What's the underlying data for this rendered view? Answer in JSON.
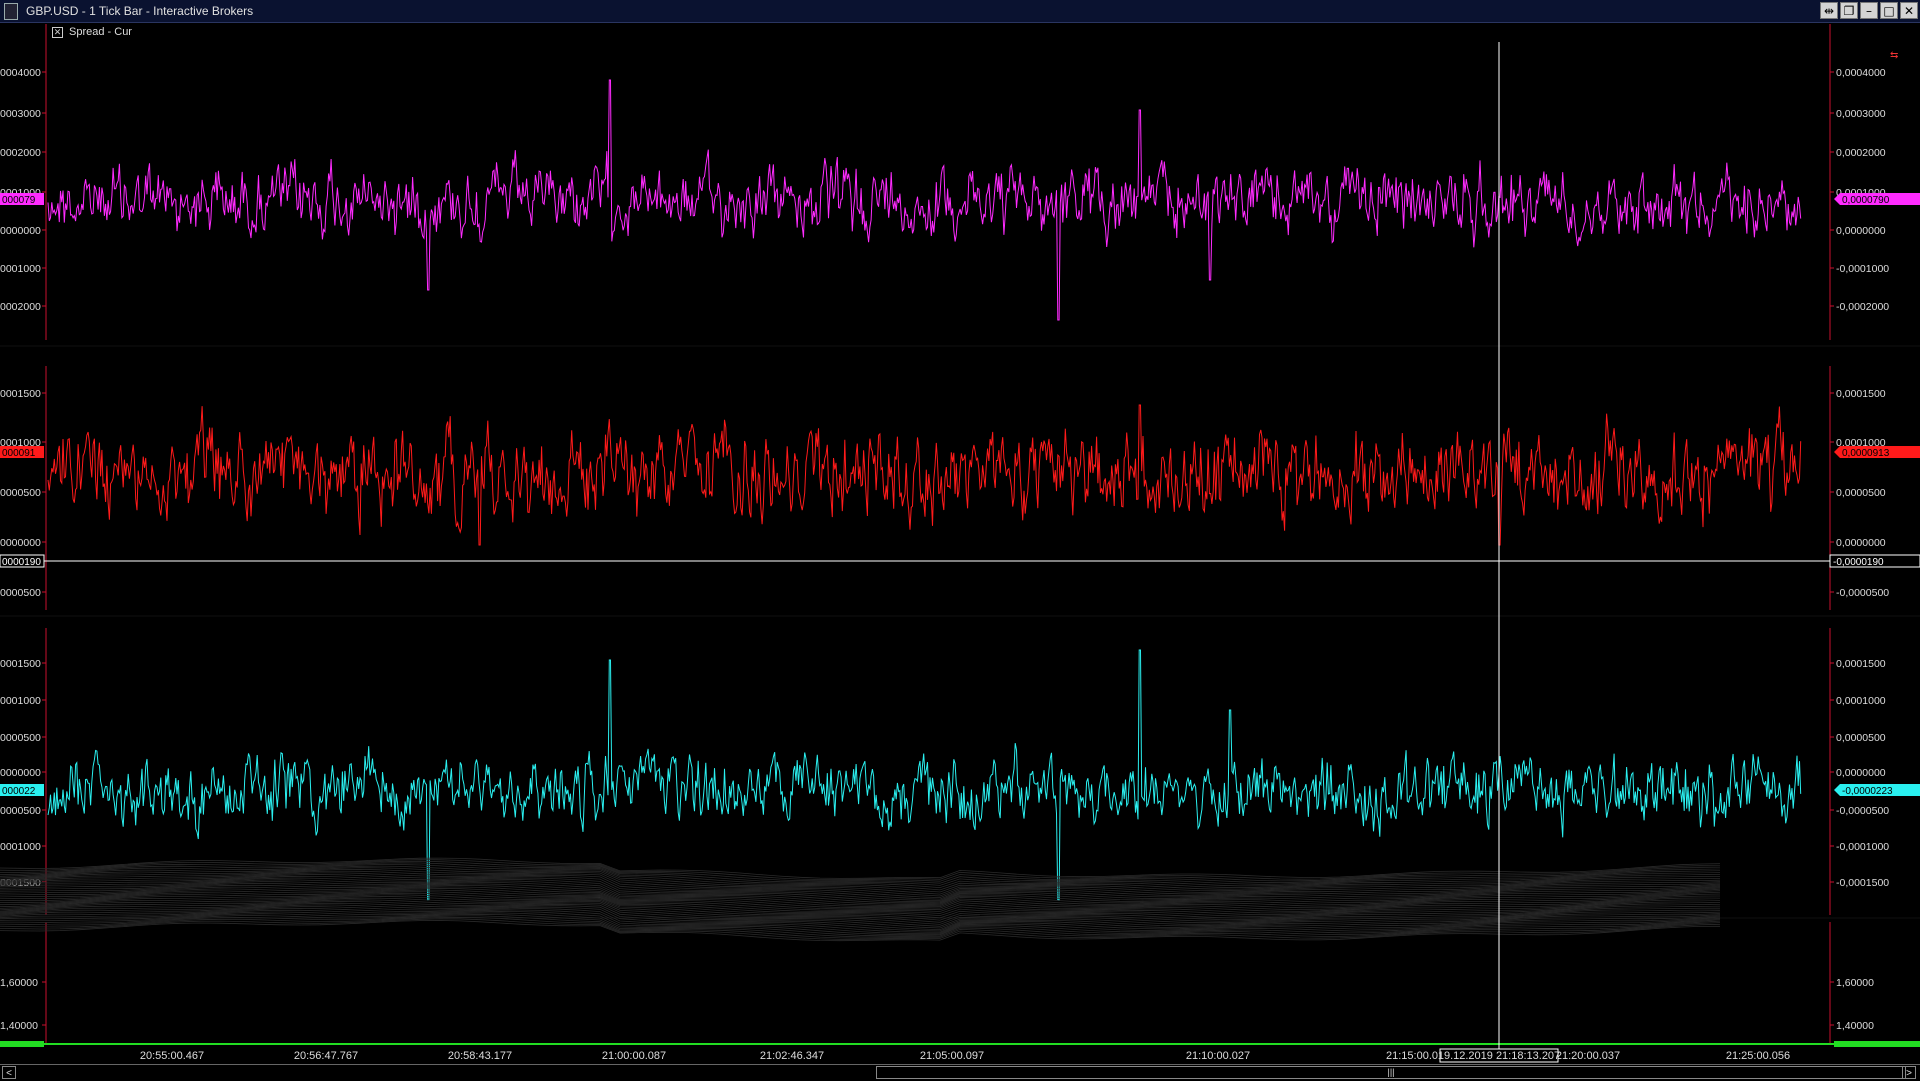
{
  "window": {
    "title": "GBP.USD - 1 Tick Bar - Interactive Brokers",
    "buttons": [
      "link-icon",
      "restore-icon",
      "minimize-icon",
      "maximize-icon",
      "close-icon"
    ]
  },
  "legend": {
    "label": "Spread - Cur"
  },
  "colors": {
    "magenta": "#ff2bff",
    "red": "#ff1a1a",
    "cyan": "#2af0f0",
    "axis": "#c8102e",
    "green": "#22dd22",
    "crosshair": "#ffffff"
  },
  "panels": [
    {
      "id": "magenta",
      "left_ticks": [
        "0004000",
        "0003000",
        "0002000",
        "0001000",
        "0000000",
        "0001000",
        "0002000"
      ],
      "right_ticks": [
        "0,0004000",
        "0,0003000",
        "0,0002000",
        "0,0001000",
        "0,0000000",
        "-0,0001000",
        "-0,0002000"
      ],
      "left_tag": "000079",
      "right_tag": "0,0000790"
    },
    {
      "id": "red",
      "left_ticks": [
        "0001500",
        "0001000",
        "0000500",
        "0000000",
        "0000500"
      ],
      "right_ticks": [
        "0,0001500",
        "0,0001000",
        "0,0000500",
        "0,0000000",
        "-0,0000500"
      ],
      "left_tag": "000091",
      "right_tag": "0,0000913",
      "crosshair_left": "0000190",
      "crosshair_right": "-0,0000190"
    },
    {
      "id": "cyan",
      "left_ticks": [
        "0001500",
        "0001000",
        "0000500",
        "0000000",
        "0000500",
        "0001000",
        "0001500"
      ],
      "right_ticks": [
        "0,0001500",
        "0,0001000",
        "0,0000500",
        "0,0000000",
        "-0,0000500",
        "-0,0001000",
        "-0,0001500"
      ],
      "left_tag": "000022",
      "right_tag": "-0,0000223"
    },
    {
      "id": "bottom",
      "left_ticks": [
        "1,60000",
        "1,40000"
      ],
      "right_ticks": [
        "1,60000",
        "1,40000"
      ]
    }
  ],
  "time_axis": {
    "labels": [
      "20:55:00.467",
      "20:56:47.767",
      "20:58:43.177",
      "21:00:00.087",
      "21:02:46.347",
      "21:05:00.097",
      "21:10:00.027",
      "21:15:00.0",
      "21:20:00.037",
      "21:25:00.056"
    ],
    "crosshair_time": "19.12.2019 21:18:13.207"
  },
  "scrollbar": {
    "left_arrow": "<",
    "right_arrow": ">",
    "thumb_grip": "|||"
  }
}
